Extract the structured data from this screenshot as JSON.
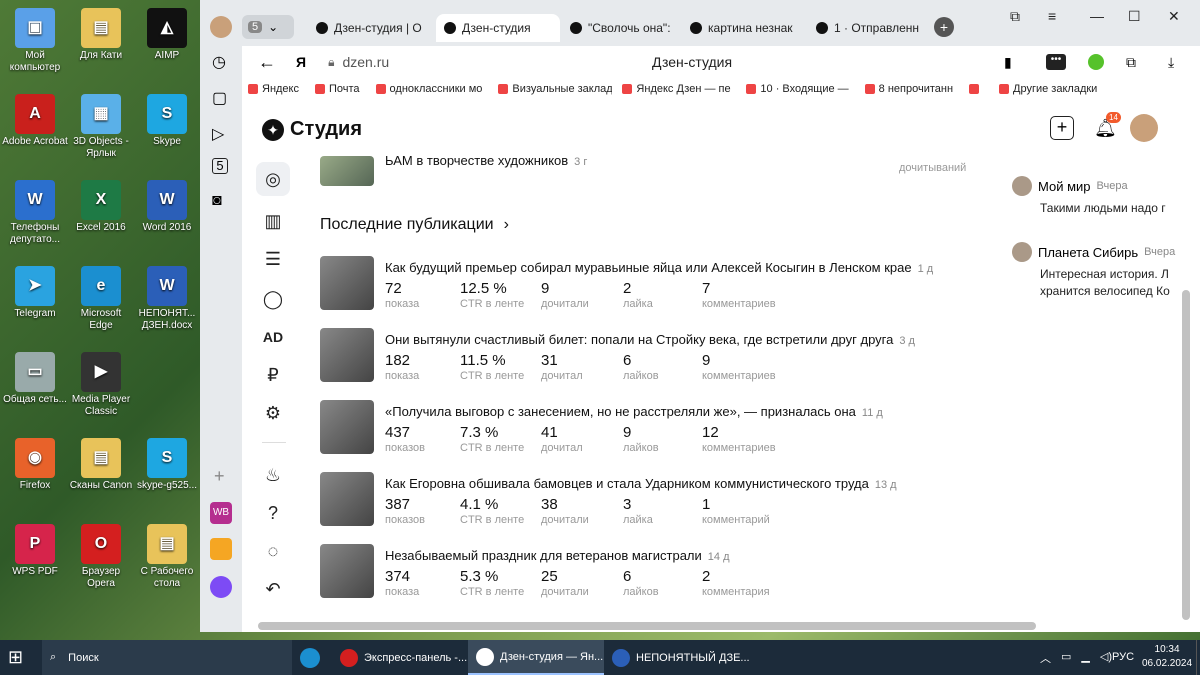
{
  "desktop": {
    "icons": [
      {
        "label": "Мой компьютер",
        "color": "#5aa0e8",
        "sym": "▣"
      },
      {
        "label": "Для Кати",
        "color": "#e8c35a",
        "sym": "▤"
      },
      {
        "label": "AIMP",
        "color": "#111",
        "sym": "◭"
      },
      {
        "label": "Adobe Acrobat",
        "color": "#c9201c",
        "sym": "A"
      },
      {
        "label": "3D Objects - Ярлык",
        "color": "#5ab0e8",
        "sym": "▦"
      },
      {
        "label": "Skype",
        "color": "#1ea7e1",
        "sym": "S"
      },
      {
        "label": "Телефоны депутато...",
        "color": "#2b6fce",
        "sym": "W"
      },
      {
        "label": "Excel 2016",
        "color": "#1e7a45",
        "sym": "X"
      },
      {
        "label": "Word 2016",
        "color": "#2b5fb8",
        "sym": "W"
      },
      {
        "label": "Telegram",
        "color": "#2aa3e0",
        "sym": "➤"
      },
      {
        "label": "Microsoft Edge",
        "color": "#1b8fd0",
        "sym": "e"
      },
      {
        "label": "НЕПОНЯТ... ДЗЕН.docx",
        "color": "#2b5fb8",
        "sym": "W"
      },
      {
        "label": "Общая сеть...",
        "color": "#9aa",
        "sym": "▭"
      },
      {
        "label": "Media Player Classic",
        "color": "#333",
        "sym": "▶"
      },
      {
        "label": "",
        "color": "transparent",
        "sym": ""
      },
      {
        "label": "Firefox",
        "color": "#e8622a",
        "sym": "◉"
      },
      {
        "label": "Сканы Canon",
        "color": "#e8c35a",
        "sym": "▤"
      },
      {
        "label": "skype-g525...",
        "color": "#1ea7e1",
        "sym": "S"
      },
      {
        "label": "WPS PDF",
        "color": "#d6244b",
        "sym": "P"
      },
      {
        "label": "Браузер Opera",
        "color": "#d41f1f",
        "sym": "O"
      },
      {
        "label": "С Рабочего стола",
        "color": "#e8c35a",
        "sym": "▤"
      }
    ]
  },
  "browser": {
    "tabs": [
      {
        "label": "Дзен-студия | О",
        "active": false
      },
      {
        "label": "Дзен-студия",
        "active": true
      },
      {
        "label": "\"Сволочь она\":",
        "active": false
      },
      {
        "label": "картина незнак",
        "active": false
      },
      {
        "label": "1 · Отправленн",
        "active": false
      }
    ],
    "url": "dzen.ru",
    "page_title": "Дзен-студия",
    "bookmarks": [
      "Яндекс",
      "Почта",
      "одноклассники мо",
      "Визуальные закладк",
      "Яндекс Дзен — пе",
      "10 · Входящие —",
      "8 непрочитанн",
      "",
      "Другие закладки"
    ],
    "tab_badge": "5"
  },
  "studio": {
    "logo": "Студия",
    "notif_count": "14",
    "prev_title": "ЬАМ в творчестве художников",
    "prev_date": "3 г",
    "prev_label": "дочитываний",
    "section_title": "Последние публикации",
    "pubs": [
      {
        "title": "Как будущий премьер собирал муравьиные яйца или Алексей Косыгин в Ленском крае",
        "date": "1 д",
        "views": "72",
        "views_l": "показа",
        "ctr": "12.5 %",
        "ctr_l": "CTR в ленте",
        "reads": "9",
        "reads_l": "дочитали",
        "likes": "2",
        "likes_l": "лайка",
        "comments": "7",
        "comments_l": "комментариев"
      },
      {
        "title": "Они вытянули счастливый билет: попали на Стройку века, где встретили друг друга",
        "date": "3 д",
        "views": "182",
        "views_l": "показа",
        "ctr": "11.5 %",
        "ctr_l": "CTR в ленте",
        "reads": "31",
        "reads_l": "дочитал",
        "likes": "6",
        "likes_l": "лайков",
        "comments": "9",
        "comments_l": "комментариев"
      },
      {
        "title": "«Получила выговор с занесением, но не расстреляли же», — призналась она",
        "date": "11 д",
        "views": "437",
        "views_l": "показов",
        "ctr": "7.3 %",
        "ctr_l": "CTR в ленте",
        "reads": "41",
        "reads_l": "дочитал",
        "likes": "9",
        "likes_l": "лайков",
        "comments": "12",
        "comments_l": "комментариев"
      },
      {
        "title": "Как Егоровна обшивала бамовцев и стала Ударником коммунистического труда",
        "date": "13 д",
        "views": "387",
        "views_l": "показов",
        "ctr": "4.1 %",
        "ctr_l": "CTR в ленте",
        "reads": "38",
        "reads_l": "дочитали",
        "likes": "3",
        "likes_l": "лайка",
        "comments": "1",
        "comments_l": "комментарий"
      },
      {
        "title": "Незабываемый праздник для ветеранов магистрали",
        "date": "14 д",
        "views": "374",
        "views_l": "показа",
        "ctr": "5.3 %",
        "ctr_l": "CTR в ленте",
        "reads": "25",
        "reads_l": "дочитали",
        "likes": "6",
        "likes_l": "лайков",
        "comments": "2",
        "comments_l": "комментария"
      }
    ],
    "comments": [
      {
        "author": "Мой мир",
        "when": "Вчера",
        "text": "Такими людьми надо г"
      },
      {
        "author": "Планета Сибирь",
        "when": "Вчера",
        "text": "Интересная история. Л хранится велосипед Ко"
      }
    ],
    "side_ad": "AD",
    "side_rub": "₽"
  },
  "taskbar": {
    "search": "Поиск",
    "items": [
      {
        "label": "Экспресс-панель -...",
        "active": false,
        "color": "#d41f1f"
      },
      {
        "label": "Дзен-студия — Ян...",
        "active": true,
        "color": "#fff"
      },
      {
        "label": "НЕПОНЯТНЫЙ ДЗЕ...",
        "active": false,
        "color": "#2b5fb8"
      }
    ],
    "lang": "РУС",
    "time": "10:34",
    "date": "06.02.2024"
  }
}
